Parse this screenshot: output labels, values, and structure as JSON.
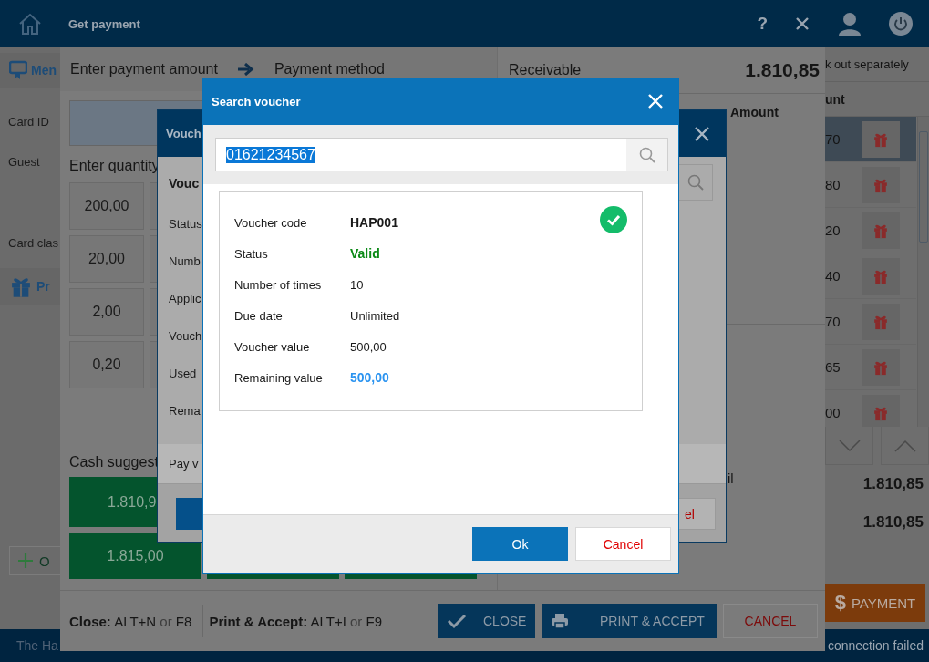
{
  "app": {
    "sidebar": {
      "member_tab": "Men",
      "fields": [
        "Card ID",
        "Guest",
        "Card clas"
      ],
      "promo_tab": "Pr",
      "add_button": "O"
    },
    "right_panel": {
      "note": "k out separately",
      "column": "unt",
      "rows": [
        {
          "amount": "70",
          "selected": true
        },
        {
          "amount": "80",
          "selected": false
        },
        {
          "amount": "20",
          "selected": false
        },
        {
          "amount": "40",
          "selected": false
        },
        {
          "amount": "70",
          "selected": false
        },
        {
          "amount": "65",
          "selected": false
        },
        {
          "amount": "00",
          "selected": false
        }
      ],
      "totals": [
        "1.810,85",
        "1.810,85"
      ],
      "payment_button": {
        "symbol": "$",
        "label": "PAYMENT"
      }
    },
    "status_bar": {
      "left": "The Ha",
      "right": "connection failed"
    }
  },
  "get_payment": {
    "title": "Get payment",
    "help": "?",
    "steps": [
      "Enter payment amount",
      "Payment method"
    ],
    "quantity_label": "Enter quantity",
    "quick_amounts": [
      "200,00",
      "20,00",
      "2,00",
      "0,20"
    ],
    "cash_label": "Cash suggest",
    "cash_suggestions": [
      "1.810,9",
      "1.815,00"
    ],
    "receivable": {
      "label": "Receivable",
      "value": "1.810,85"
    },
    "amount_column": "Amount",
    "summary_label": "il",
    "shortcuts": [
      {
        "action": "Close:",
        "keys": "ALT+N",
        "joiner": "or",
        "alt": "F8"
      },
      {
        "action": "Print & Accept:",
        "keys": "ALT+I",
        "joiner": "or",
        "alt": "F9"
      }
    ],
    "buttons": [
      {
        "label": "CLOSE",
        "kind": "close"
      },
      {
        "label": "PRINT & ACCEPT",
        "kind": "print"
      },
      {
        "label": "CANCEL",
        "kind": "cancel"
      }
    ]
  },
  "voucher": {
    "title": "Vouch",
    "heading": "Vouc",
    "labels": [
      "Status",
      "Numb",
      "Applic",
      "Vouch",
      "Used",
      "Rema"
    ],
    "pay_label": "Pay v",
    "cancel_button": "el"
  },
  "search_voucher": {
    "title": "Search voucher",
    "query": "01621234567",
    "query_selected": true,
    "details": [
      {
        "label": "Voucher code",
        "value": "HAP001",
        "kind": "code"
      },
      {
        "label": "Status",
        "value": "Valid",
        "kind": "valid"
      },
      {
        "label": "Number of times",
        "value": "10",
        "kind": "plain"
      },
      {
        "label": "Due date",
        "value": "Unlimited",
        "kind": "plain"
      },
      {
        "label": "Voucher value",
        "value": "500,00",
        "kind": "plain"
      },
      {
        "label": "Remaining value",
        "value": "500,00",
        "kind": "highlight"
      }
    ],
    "buttons": [
      {
        "label": "Ok",
        "kind": "primary"
      },
      {
        "label": "Cancel",
        "kind": "secondary"
      }
    ]
  }
}
